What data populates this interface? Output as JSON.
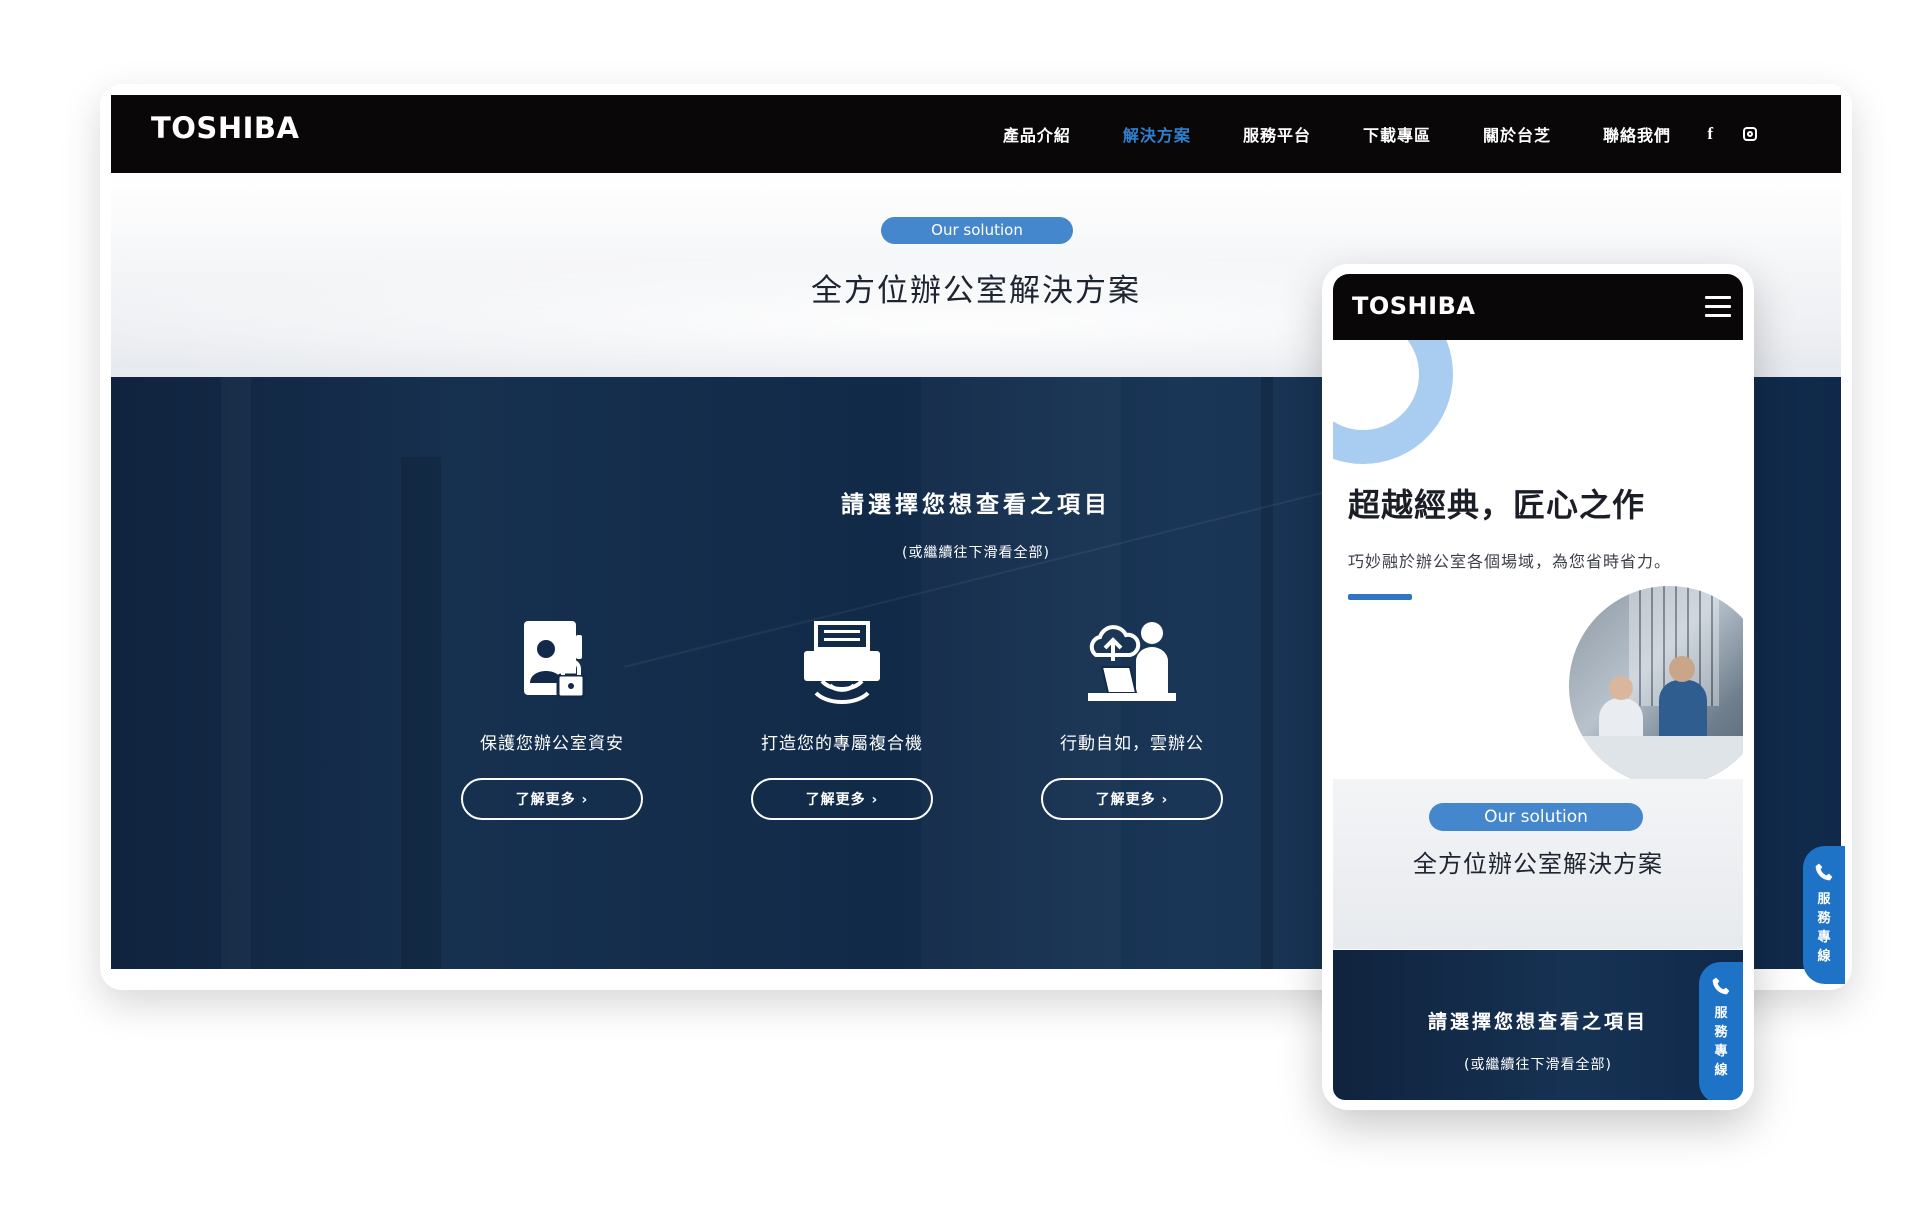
{
  "desktop": {
    "logo": "TOSHIBA",
    "nav": {
      "items": [
        {
          "label": "產品介紹",
          "active": false
        },
        {
          "label": "解決方案",
          "active": true
        },
        {
          "label": "服務平台",
          "active": false
        },
        {
          "label": "下載專區",
          "active": false
        },
        {
          "label": "關於台芝",
          "active": false
        },
        {
          "label": "聯絡我們",
          "active": false
        }
      ],
      "social": {
        "facebook": "f",
        "instagram_icon": "instagram-icon"
      }
    },
    "hero": {
      "pill": "Our solution",
      "title": "全方位辦公室解決方案"
    },
    "select": {
      "heading": "請選擇您想查看之項目",
      "sub": "(或繼續往下滑看全部)",
      "features": [
        {
          "icon": "security-lock-icon",
          "label": "保護您辦公室資安",
          "button": "了解更多 ›"
        },
        {
          "icon": "printer-icon",
          "label": "打造您的專屬複合機",
          "button": "了解更多 ›"
        },
        {
          "icon": "cloud-office-icon",
          "label": "行動自如，雲辦公",
          "button": "了解更多 ›"
        }
      ]
    },
    "service_tab": {
      "icon": "phone-icon",
      "label": "服務專線"
    }
  },
  "mobile": {
    "logo": "TOSHIBA",
    "menu_icon": "hamburger-icon",
    "headline": "超越經典，匠心之作",
    "desc": "巧妙融於辦公室各個場域，為您省時省力。",
    "pill": "Our solution",
    "title": "全方位辦公室解決方案",
    "select": {
      "heading": "請選擇您想查看之項目",
      "sub": "(或繼續往下滑看全部)"
    },
    "service_tab": {
      "icon": "phone-icon",
      "label": "服務專線"
    }
  },
  "colors": {
    "nav_bg": "#0a0708",
    "accent_blue": "#2f80cf",
    "pill_blue": "#4587cc",
    "dark_navy": "#10233e",
    "service_tab": "#1e73c6"
  }
}
